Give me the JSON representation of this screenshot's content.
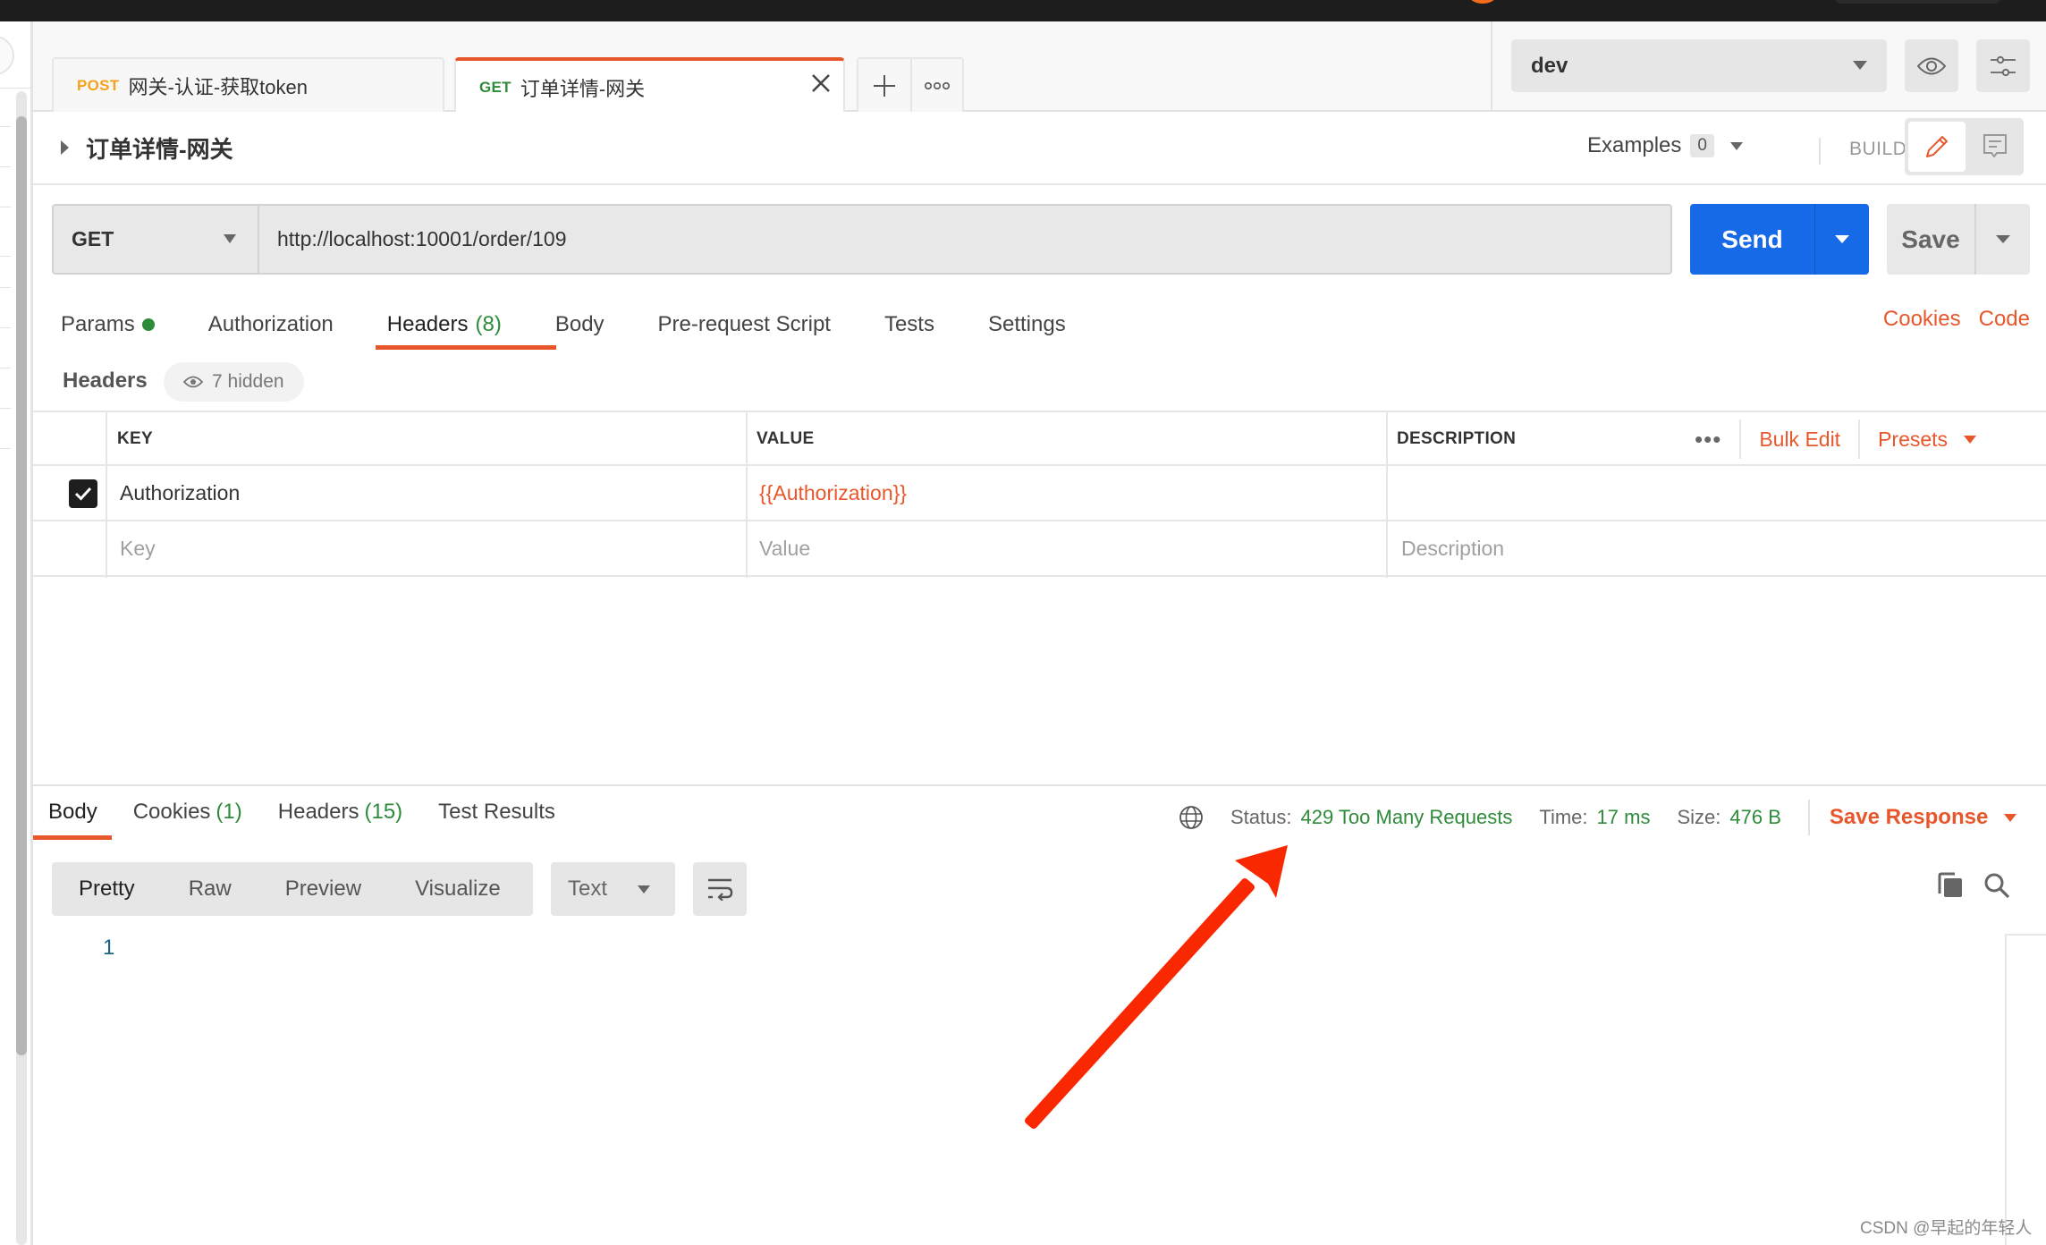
{
  "tabs": [
    {
      "method": "POST",
      "title": "网关-认证-获取token",
      "active": false
    },
    {
      "method": "GET",
      "title": "订单详情-网关",
      "active": true
    }
  ],
  "tab_actions": {
    "new_tab": "+",
    "more": "ooo"
  },
  "environment": {
    "selected": "dev"
  },
  "request": {
    "name": "订单详情-网关",
    "examples_label": "Examples",
    "examples_count": "0",
    "mode_label": "BUILD",
    "method": "GET",
    "url": "http://localhost:10001/order/109",
    "send_label": "Send",
    "save_label": "Save"
  },
  "request_tabs": [
    {
      "label": "Params",
      "count": "",
      "dot": true
    },
    {
      "label": "Authorization",
      "count": ""
    },
    {
      "label": "Headers",
      "count": "(8)",
      "active": true
    },
    {
      "label": "Body",
      "count": ""
    },
    {
      "label": "Pre-request Script",
      "count": ""
    },
    {
      "label": "Tests",
      "count": ""
    },
    {
      "label": "Settings",
      "count": ""
    }
  ],
  "request_links": {
    "cookies": "Cookies",
    "code": "Code"
  },
  "headers_section": {
    "label": "Headers",
    "hidden_label": "7 hidden",
    "columns": [
      "KEY",
      "VALUE",
      "DESCRIPTION"
    ],
    "more_label": "•••",
    "bulk_edit": "Bulk Edit",
    "presets": "Presets",
    "rows": [
      {
        "checked": true,
        "key": "Authorization",
        "value": "{{Authorization}}",
        "description": ""
      }
    ],
    "placeholders": {
      "key": "Key",
      "value": "Value",
      "description": "Description"
    }
  },
  "response": {
    "tabs": [
      {
        "label": "Body",
        "count": "",
        "active": true
      },
      {
        "label": "Cookies",
        "count": "(1)"
      },
      {
        "label": "Headers",
        "count": "(15)"
      },
      {
        "label": "Test Results",
        "count": ""
      }
    ],
    "status_label": "Status:",
    "status_value": "429 Too Many Requests",
    "time_label": "Time:",
    "time_value": "17 ms",
    "size_label": "Size:",
    "size_value": "476 B",
    "save_response": "Save Response",
    "view_modes": [
      "Pretty",
      "Raw",
      "Preview",
      "Visualize"
    ],
    "active_view_mode": "Pretty",
    "format": "Text",
    "line_numbers": [
      "1"
    ]
  },
  "colors": {
    "accent": "#e8572c",
    "send_blue": "#1669e7",
    "success_green": "#2e8b3a",
    "post_orange": "#f5a21b",
    "annotation_red": "#f92800"
  },
  "watermark": "CSDN @早起的年轻人"
}
